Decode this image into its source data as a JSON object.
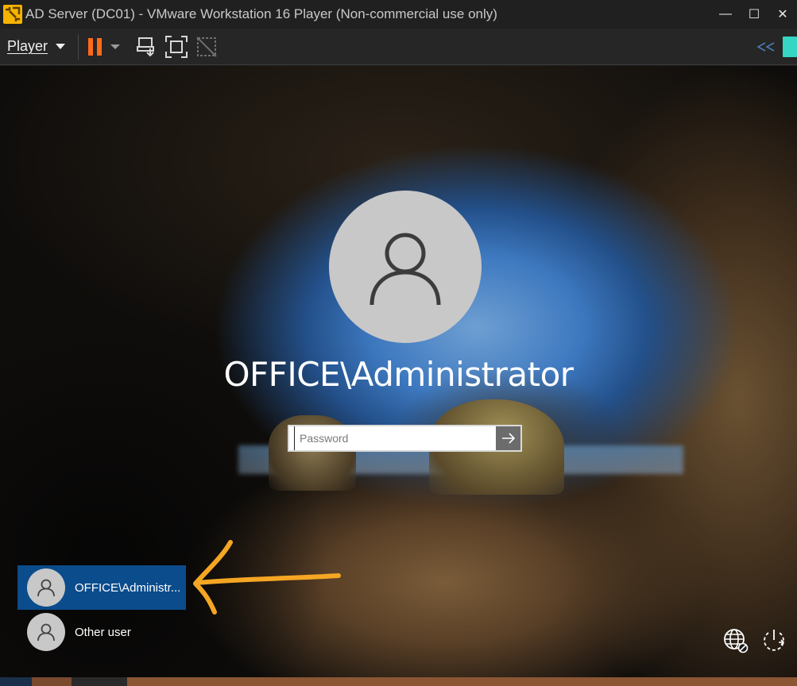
{
  "window": {
    "title": "AD Server (DC01) - VMware Workstation 16 Player (Non-commercial use only)",
    "minimize_glyph": "—",
    "maximize_glyph": "☐",
    "close_glyph": "✕"
  },
  "toolbar": {
    "player_label": "Player",
    "icons": [
      "pause-icon",
      "send-ctrl-alt-del-icon",
      "fullscreen-icon",
      "unity-icon",
      "collapse-icon",
      "library-toggle-icon"
    ],
    "accent_color": "#ff7a2a",
    "library_color": "#35d6c4"
  },
  "login": {
    "username": "OFFICE\\Administrator",
    "password_placeholder": "Password",
    "submit_icon": "arrow-right-icon"
  },
  "user_list": [
    {
      "label": "OFFICE\\Administr...",
      "selected": true
    },
    {
      "label": "Other user",
      "selected": false
    }
  ],
  "corner": {
    "icons": [
      "network-icon",
      "power-icon"
    ]
  },
  "annotation": {
    "color": "#f5a623",
    "type": "hand-drawn-arrow"
  }
}
